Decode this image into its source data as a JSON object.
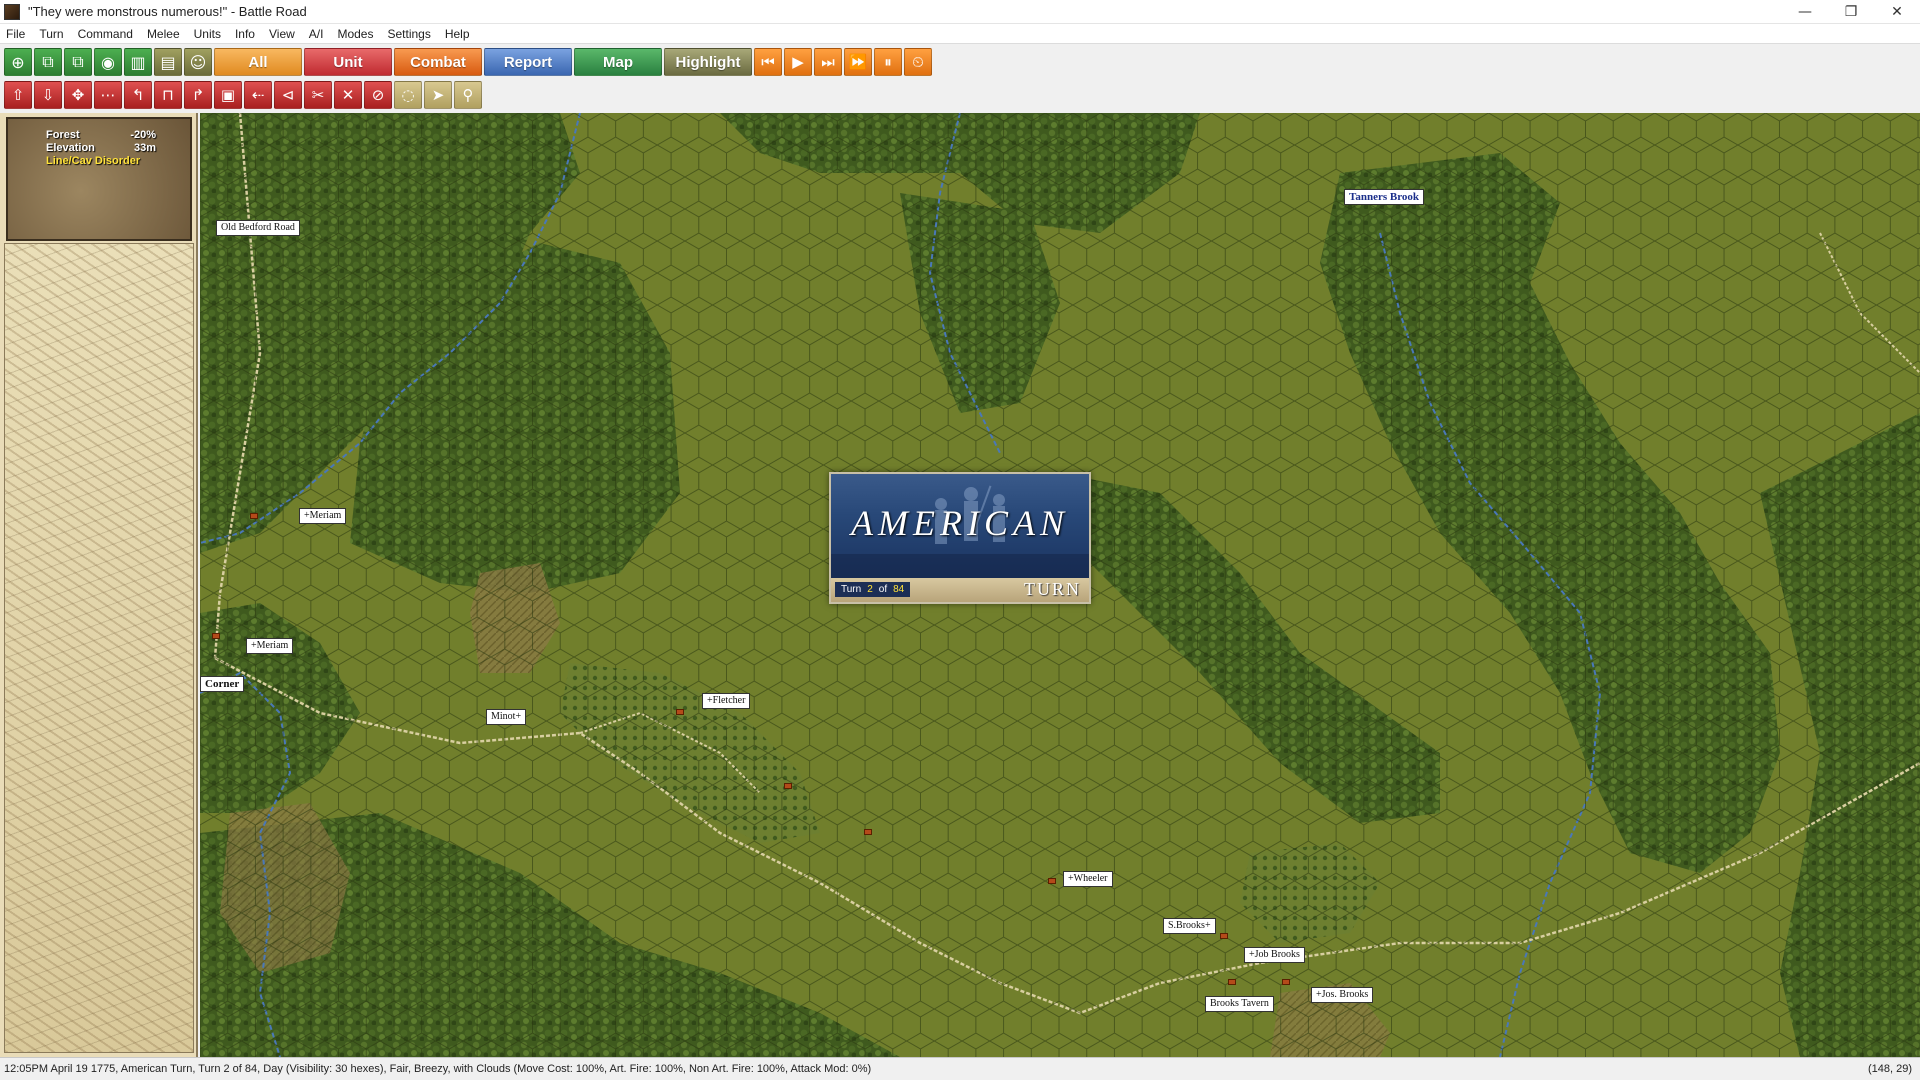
{
  "window": {
    "title": "\"They were monstrous numerous!\" - Battle Road",
    "controls": [
      "—",
      "❐",
      "✕"
    ]
  },
  "menu": [
    "File",
    "Turn",
    "Command",
    "Melee",
    "Units",
    "Info",
    "View",
    "A/I",
    "Modes",
    "Settings",
    "Help"
  ],
  "toolbar": {
    "icons_left": [
      "⊕",
      "⧉",
      "⧉",
      "◉",
      "▥",
      "▤",
      "☺"
    ],
    "tabs": [
      {
        "label": "All",
        "color": "#f4a340"
      },
      {
        "label": "Unit",
        "color": "#d9474a"
      },
      {
        "label": "Combat",
        "color": "#f07a30"
      },
      {
        "label": "Report",
        "color": "#5a86c8"
      },
      {
        "label": "Map",
        "color": "#3f9a50"
      },
      {
        "label": "Highlight",
        "color": "#8a8a5a"
      }
    ],
    "playback": [
      "⏮",
      "▶",
      "⏭",
      "⏩",
      "⏸",
      "⏲"
    ]
  },
  "toolbar2": {
    "red_icons": [
      "⇧",
      "⇩",
      "✥",
      "⋯",
      "↰",
      "⊓",
      "↱",
      "▣",
      "⇠",
      "⊲",
      "✂",
      "✕",
      "⊘"
    ],
    "tan_icons": [
      "◌",
      "➤",
      "⚲"
    ]
  },
  "terrain": {
    "rows": [
      {
        "label": "Forest",
        "value": "-20%"
      },
      {
        "label": "Elevation",
        "value": "33m"
      }
    ],
    "warning": "Line/Cav Disorder"
  },
  "map": {
    "labels": [
      {
        "id": "old-bedford-road",
        "text": "Old Bedford Road",
        "style": ""
      },
      {
        "id": "tanners-brook",
        "text": "Tanners Brook",
        "style": "blue"
      },
      {
        "id": "meriam-1",
        "text": "+Meriam",
        "style": ""
      },
      {
        "id": "meriam-2",
        "text": "+Meriam",
        "style": ""
      },
      {
        "id": "corner",
        "text": "Corner",
        "style": "bold"
      },
      {
        "id": "minot",
        "text": "Minot+",
        "style": ""
      },
      {
        "id": "fletcher",
        "text": "+Fletcher",
        "style": ""
      },
      {
        "id": "wheeler",
        "text": "+Wheeler",
        "style": ""
      },
      {
        "id": "s-brooks",
        "text": "S.Brooks+",
        "style": ""
      },
      {
        "id": "job-brooks",
        "text": "+Job Brooks",
        "style": ""
      },
      {
        "id": "jos-brooks",
        "text": "+Jos. Brooks",
        "style": ""
      },
      {
        "id": "brooks-tavern",
        "text": "Brooks Tavern",
        "style": ""
      }
    ]
  },
  "banner": {
    "side": "AMERICAN",
    "turn_label": "Turn",
    "turn_current": "2",
    "of_label": "of",
    "turn_total": "84",
    "turn_word": "TURN"
  },
  "status": {
    "message": "12:05PM April 19 1775, American Turn, Turn 2 of 84, Day (Visibility: 30 hexes), Fair, Breezy, with Clouds (Move Cost: 100%, Art. Fire: 100%, Non Art. Fire: 100%, Attack Mod: 0%)",
    "coord": "(148, 29)"
  }
}
